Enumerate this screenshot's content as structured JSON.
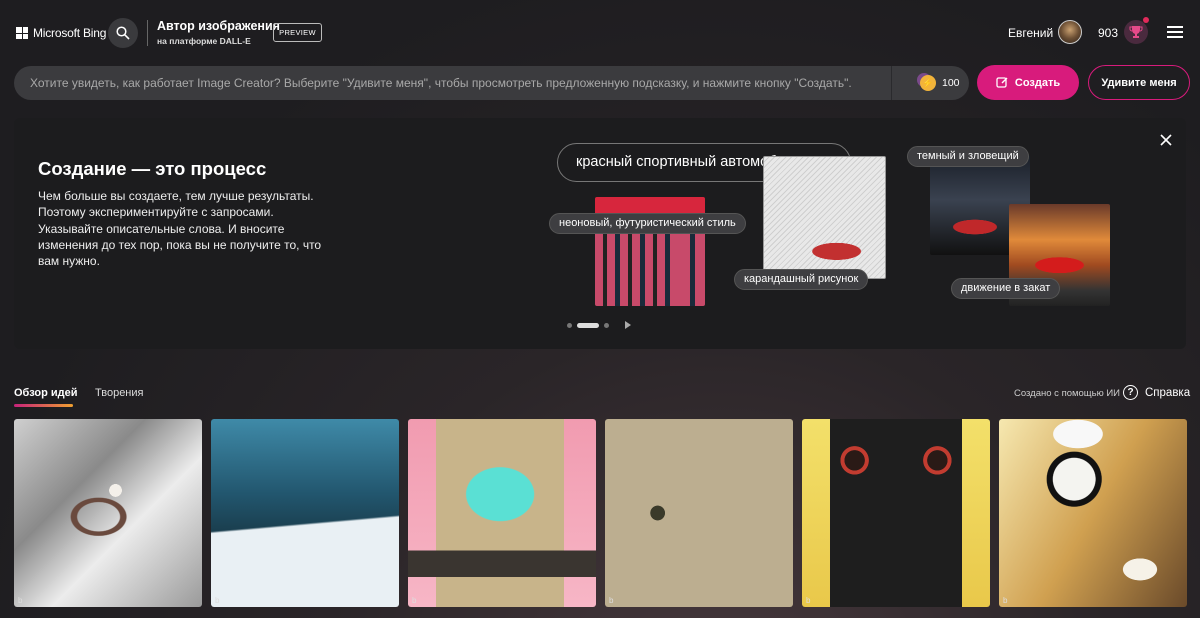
{
  "header": {
    "brand": "Microsoft Bing",
    "app_title": "Автор изображения",
    "app_subtitle": "на платформе DALL-E",
    "preview_badge": "PREVIEW",
    "user_name": "Евгений",
    "points": "903"
  },
  "prompt": {
    "placeholder": "Хотите увидеть, как работает Image Creator? Выберите \"Удивите меня\", чтобы просмотреть предложенную подсказку, и нажмите кнопку \"Создать\".",
    "boosts": "100",
    "create_label": "Создать",
    "surprise_label": "Удивите меня"
  },
  "hero": {
    "title": "Создание — это процесс",
    "text": "Чем больше вы создаете, тем лучше результаты. Поэтому экспериментируйте с запросами. Указывайте описательные слова. И вносите изменения до тех пор, пока вы не получите то, что вам нужно.",
    "prompt_example": "красный спортивный автомобиль",
    "tags": {
      "neon": "неоновый, футуристический стиль",
      "pencil": "карандашный рисунок",
      "dark": "темный и зловещий",
      "sunset": "движение в закат"
    },
    "carousel": {
      "pages": 3,
      "active": 2
    }
  },
  "tabs": {
    "ideas": "Обзор идей",
    "creations": "Творения"
  },
  "ai_note": "Создано с помощью ИИ",
  "help_label": "Справка",
  "gallery_mark": "b"
}
